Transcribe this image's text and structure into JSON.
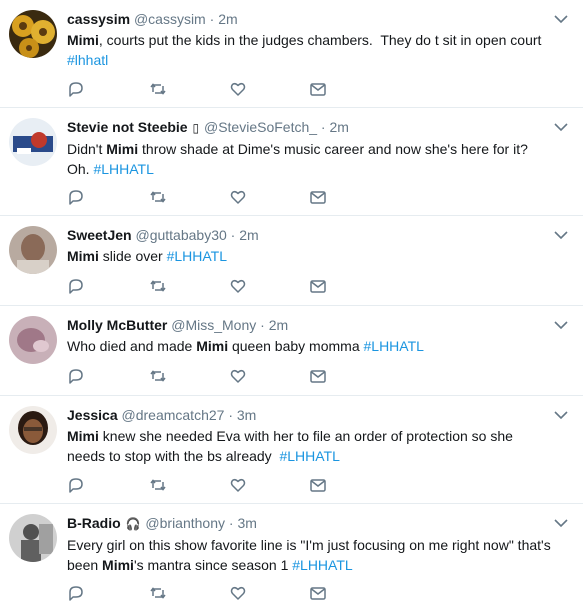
{
  "tweets": [
    {
      "name": "cassysim",
      "handle": "@cassysim",
      "time": "2m",
      "badge": "",
      "segments": [
        {
          "t": "Mimi",
          "b": true
        },
        {
          "t": ", courts put the kids in the judges chambers.  They do t sit in open court "
        },
        {
          "t": "#lhhatl",
          "tag": true
        }
      ]
    },
    {
      "name": "Stevie not Steebie",
      "handle": "@StevieSoFetch_",
      "time": "2m",
      "badge": "▯",
      "segments": [
        {
          "t": "Didn't "
        },
        {
          "t": "Mimi",
          "b": true
        },
        {
          "t": " throw shade at Dime's music career and now she's here for it? Oh. "
        },
        {
          "t": "#LHHATL",
          "tag": true
        }
      ]
    },
    {
      "name": "SweetJen",
      "handle": "@guttababy30",
      "time": "2m",
      "badge": "",
      "segments": [
        {
          "t": "Mimi",
          "b": true
        },
        {
          "t": " slide over "
        },
        {
          "t": "#LHHATL",
          "tag": true
        }
      ]
    },
    {
      "name": "Molly McButter",
      "handle": "@Miss_Mony",
      "time": "2m",
      "badge": "",
      "segments": [
        {
          "t": "Who died and made "
        },
        {
          "t": "Mimi",
          "b": true
        },
        {
          "t": " queen baby momma "
        },
        {
          "t": "#LHHATL",
          "tag": true
        }
      ]
    },
    {
      "name": "Jessica",
      "handle": "@dreamcatch27",
      "time": "3m",
      "badge": "",
      "segments": [
        {
          "t": "Mimi",
          "b": true
        },
        {
          "t": " knew she needed Eva with her to file an order of protection so she needs to stop with the bs already  "
        },
        {
          "t": "#LHHATL",
          "tag": true
        }
      ]
    },
    {
      "name": "B-Radio",
      "handle": "@brianthony",
      "time": "3m",
      "badge": "🎧",
      "segments": [
        {
          "t": "Every girl on this show favorite line is \"I'm just focusing on me right now\" that's been "
        },
        {
          "t": "Mimi",
          "b": true
        },
        {
          "t": "'s mantra since season 1 "
        },
        {
          "t": "#LHHATL",
          "tag": true
        }
      ]
    }
  ],
  "icons": [
    "reply-icon",
    "retweet-icon",
    "like-icon",
    "message-icon",
    "chevron-down-icon"
  ],
  "colors": {
    "link": "#1b95e0",
    "muted": "#657786",
    "text": "#14171a",
    "divider": "#e6ecf0"
  }
}
